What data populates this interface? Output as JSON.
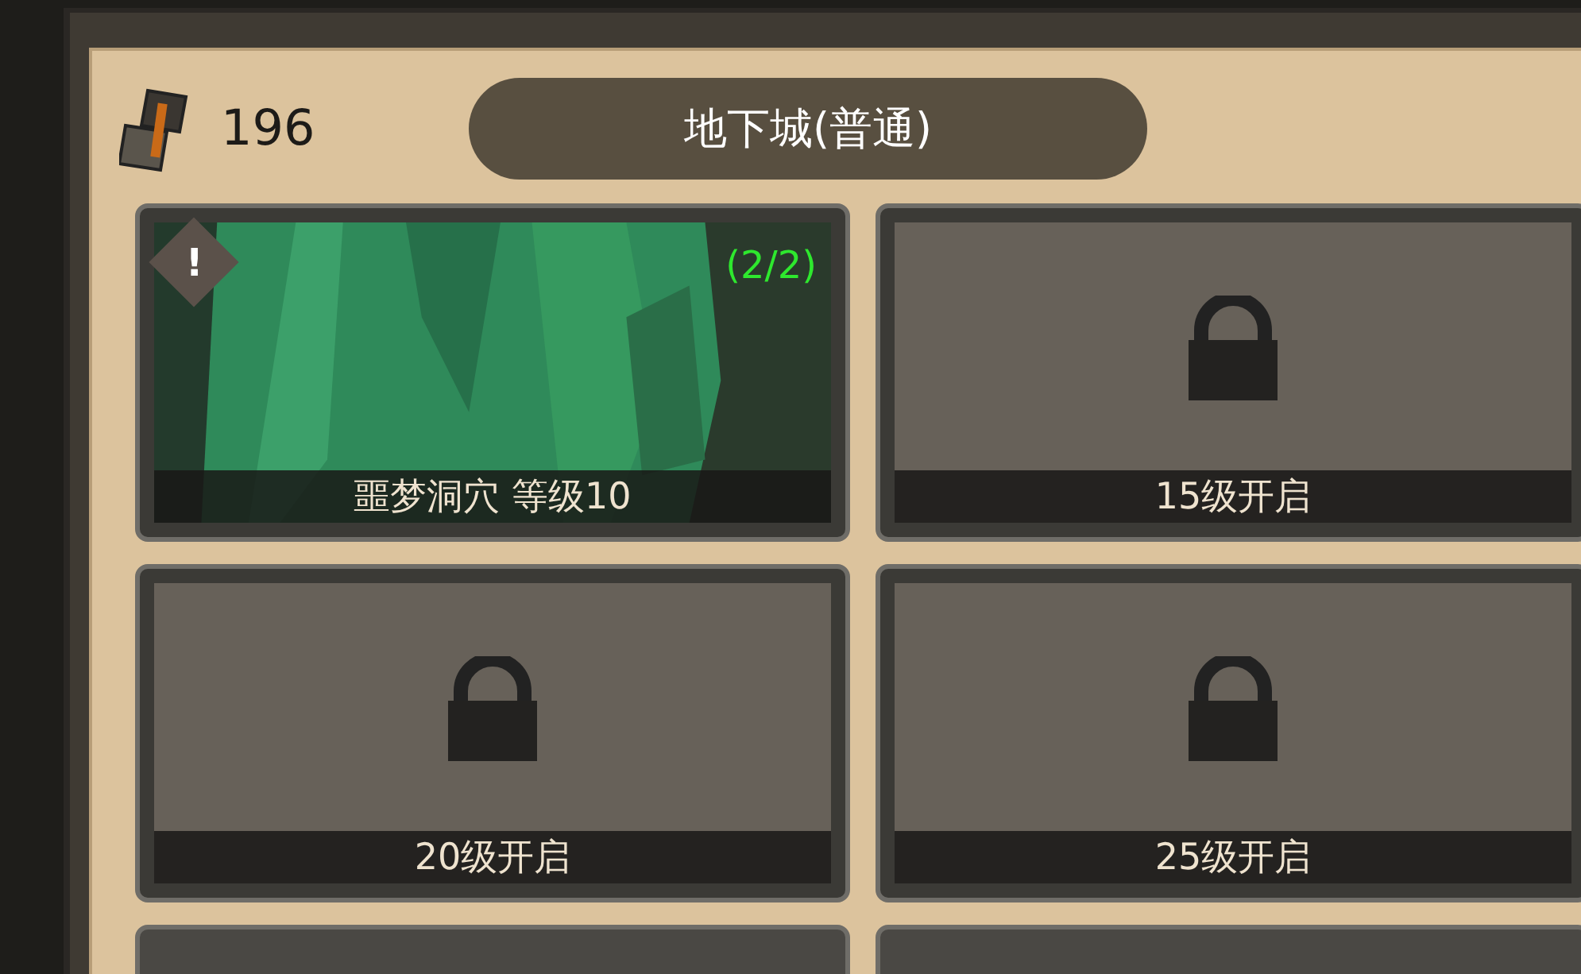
{
  "currency": {
    "amount": "196"
  },
  "title": "地下城(普通)",
  "dungeons": [
    {
      "kind": "unlocked",
      "label": "噩梦洞穴 等级10",
      "count": "(2/2)",
      "alert": "!"
    },
    {
      "kind": "locked",
      "label": "15级开启"
    },
    {
      "kind": "locked",
      "label": "20级开启"
    },
    {
      "kind": "locked",
      "label": "25级开启"
    },
    {
      "kind": "partial"
    },
    {
      "kind": "partial"
    }
  ]
}
